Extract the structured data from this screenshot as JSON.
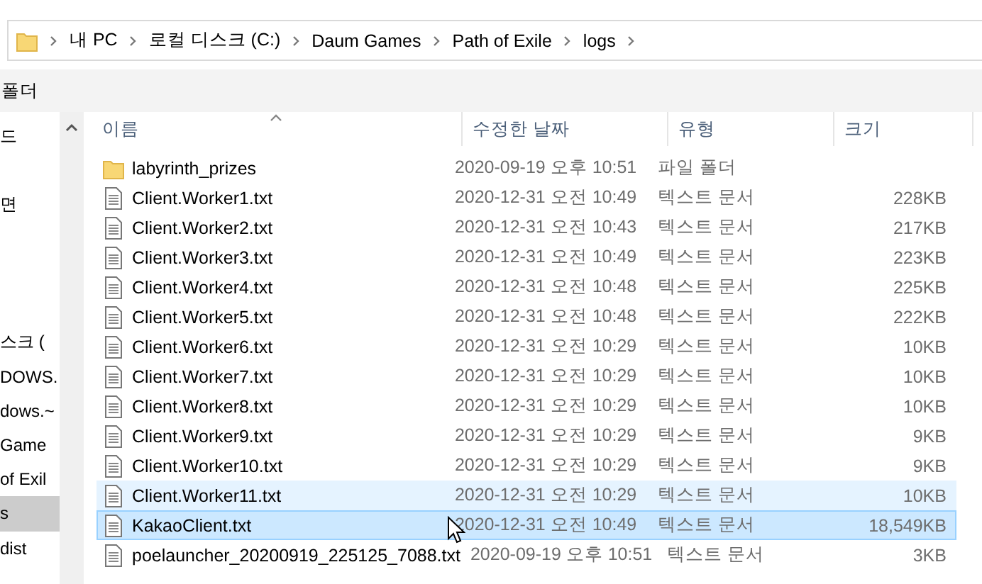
{
  "address_bar": {
    "segments": [
      "내 PC",
      "로컬 디스크 (C:)",
      "Daum Games",
      "Path of Exile",
      "logs"
    ]
  },
  "toolbar": {
    "label": "폴더"
  },
  "sidebar": {
    "groups": [
      {
        "items": [
          {
            "label": "드",
            "selected": false
          }
        ]
      },
      {
        "items": [
          {
            "label": "면",
            "selected": false
          }
        ]
      },
      {
        "items": [
          {
            "label": "스크 (",
            "selected": false
          },
          {
            "label": "DOWS.",
            "selected": false
          },
          {
            "label": "dows.~",
            "selected": false
          },
          {
            "label": "Game",
            "selected": false
          },
          {
            "label": "of Exil",
            "selected": false
          },
          {
            "label": "s",
            "selected": true
          },
          {
            "label": "dist",
            "selected": false
          }
        ]
      }
    ]
  },
  "table": {
    "columns": [
      "이름",
      "수정한 날짜",
      "유형",
      "크기"
    ],
    "rows": [
      {
        "kind": "folder",
        "name": "labyrinth_prizes",
        "date": "2020-09-19 오후 10:51",
        "type": "파일 폴더",
        "selected": false,
        "hovered": false
      },
      {
        "kind": "file",
        "name": "Client.Worker1.txt",
        "date": "2020-12-31 오전 10:49",
        "type": "텍스트 문서",
        "size": "228KB",
        "selected": false,
        "hovered": false
      },
      {
        "kind": "file",
        "name": "Client.Worker2.txt",
        "date": "2020-12-31 오전 10:43",
        "type": "텍스트 문서",
        "size": "217KB",
        "selected": false,
        "hovered": false
      },
      {
        "kind": "file",
        "name": "Client.Worker3.txt",
        "date": "2020-12-31 오전 10:49",
        "type": "텍스트 문서",
        "size": "223KB",
        "selected": false,
        "hovered": false
      },
      {
        "kind": "file",
        "name": "Client.Worker4.txt",
        "date": "2020-12-31 오전 10:48",
        "type": "텍스트 문서",
        "size": "225KB",
        "selected": false,
        "hovered": false
      },
      {
        "kind": "file",
        "name": "Client.Worker5.txt",
        "date": "2020-12-31 오전 10:48",
        "type": "텍스트 문서",
        "size": "222KB",
        "selected": false,
        "hovered": false
      },
      {
        "kind": "file",
        "name": "Client.Worker6.txt",
        "date": "2020-12-31 오전 10:29",
        "type": "텍스트 문서",
        "size": "10KB",
        "selected": false,
        "hovered": false
      },
      {
        "kind": "file",
        "name": "Client.Worker7.txt",
        "date": "2020-12-31 오전 10:29",
        "type": "텍스트 문서",
        "size": "10KB",
        "selected": false,
        "hovered": false
      },
      {
        "kind": "file",
        "name": "Client.Worker8.txt",
        "date": "2020-12-31 오전 10:29",
        "type": "텍스트 문서",
        "size": "10KB",
        "selected": false,
        "hovered": false
      },
      {
        "kind": "file",
        "name": "Client.Worker9.txt",
        "date": "2020-12-31 오전 10:29",
        "type": "텍스트 문서",
        "size": "9KB",
        "selected": false,
        "hovered": false
      },
      {
        "kind": "file",
        "name": "Client.Worker10.txt",
        "date": "2020-12-31 오전 10:29",
        "type": "텍스트 문서",
        "size": "9KB",
        "selected": false,
        "hovered": false
      },
      {
        "kind": "file",
        "name": "Client.Worker11.txt",
        "date": "2020-12-31 오전 10:29",
        "type": "텍스트 문서",
        "size": "10KB",
        "selected": false,
        "hovered": true
      },
      {
        "kind": "file",
        "name": "KakaoClient.txt",
        "date": "2020-12-31 오전 10:49",
        "type": "텍스트 문서",
        "size": "18,549KB",
        "selected": true,
        "hovered": false
      },
      {
        "kind": "file",
        "name": "poelauncher_20200919_225125_7088.txt",
        "date": "2020-09-19 오후 10:51",
        "type": "텍스트 문서",
        "size": "3KB",
        "selected": false,
        "hovered": false
      }
    ]
  }
}
